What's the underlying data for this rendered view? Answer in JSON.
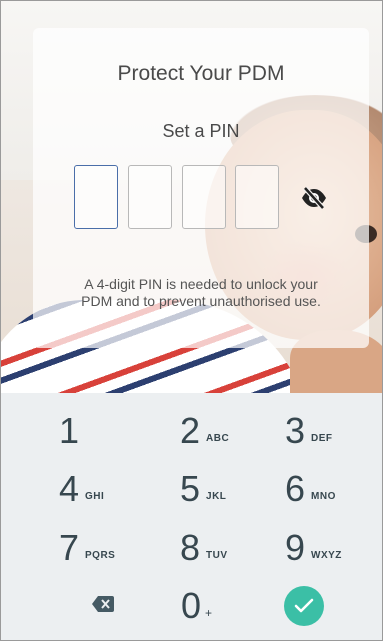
{
  "dialog": {
    "title": "Protect Your PDM",
    "subtitle": "Set a PIN",
    "help_line1": "A 4-digit PIN is needed to unlock your",
    "help_line2": "PDM and to prevent unauthorised use.",
    "pin_fields": [
      "",
      "",
      "",
      ""
    ],
    "visibility_icon": "eye-off-icon"
  },
  "keypad": {
    "keys": [
      {
        "digit": "1",
        "letters": ""
      },
      {
        "digit": "2",
        "letters": "ABC"
      },
      {
        "digit": "3",
        "letters": "DEF"
      },
      {
        "digit": "4",
        "letters": "GHI"
      },
      {
        "digit": "5",
        "letters": "JKL"
      },
      {
        "digit": "6",
        "letters": "MNO"
      },
      {
        "digit": "7",
        "letters": "PQRS"
      },
      {
        "digit": "8",
        "letters": "TUV"
      },
      {
        "digit": "9",
        "letters": "WXYZ"
      }
    ],
    "zero": {
      "digit": "0",
      "symbol": "+"
    },
    "backspace_icon": "backspace-icon",
    "confirm_icon": "checkmark-icon",
    "confirm_color": "#3bbfa6"
  }
}
